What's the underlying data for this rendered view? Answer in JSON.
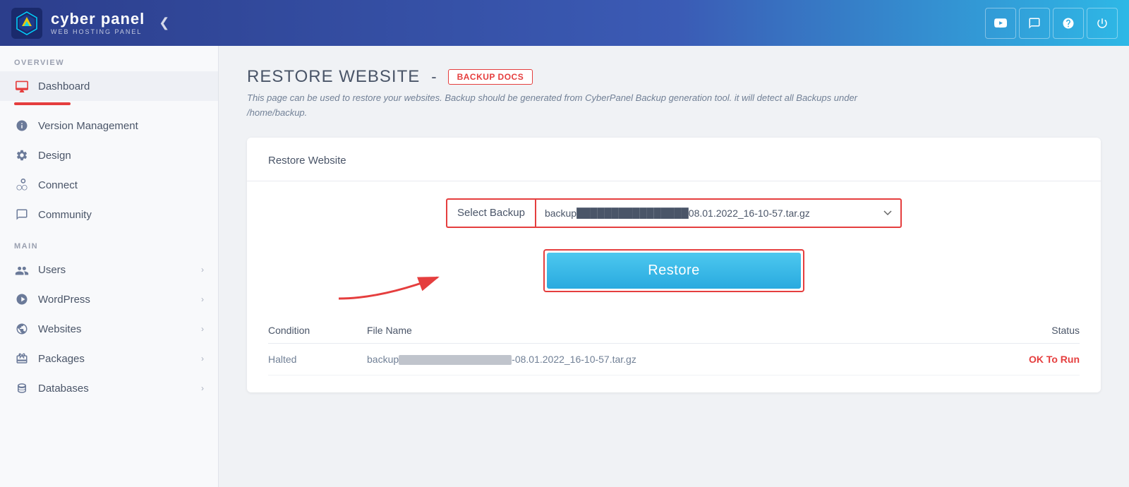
{
  "header": {
    "logo_name": "cyber panel",
    "logo_sub": "WEB HOSTING PANEL",
    "collapse_icon": "❮",
    "icons": [
      {
        "name": "youtube-icon",
        "glyph": "▶",
        "label": "YouTube"
      },
      {
        "name": "chat-icon",
        "glyph": "💬",
        "label": "Chat"
      },
      {
        "name": "help-icon",
        "glyph": "⊕",
        "label": "Help"
      },
      {
        "name": "power-icon",
        "glyph": "⏻",
        "label": "Power"
      }
    ]
  },
  "sidebar": {
    "overview_label": "OVERVIEW",
    "main_label": "MAIN",
    "items_overview": [
      {
        "id": "monitor",
        "label": "Dashboard",
        "icon": "🖥",
        "active": true
      },
      {
        "id": "version",
        "label": "Version Management",
        "icon": "ℹ"
      },
      {
        "id": "design",
        "label": "Design",
        "icon": "⚙"
      },
      {
        "id": "connect",
        "label": "Connect",
        "icon": "🔗"
      },
      {
        "id": "community",
        "label": "Community",
        "icon": "💬"
      }
    ],
    "items_main": [
      {
        "id": "users",
        "label": "Users",
        "icon": "👥",
        "arrow": "›"
      },
      {
        "id": "wordpress",
        "label": "WordPress",
        "icon": "Ⓦ",
        "arrow": "›"
      },
      {
        "id": "websites",
        "label": "Websites",
        "icon": "🌐",
        "arrow": "›"
      },
      {
        "id": "packages",
        "label": "Packages",
        "icon": "📦",
        "arrow": "›"
      },
      {
        "id": "databases",
        "label": "Databases",
        "icon": "🗄",
        "arrow": "›"
      }
    ]
  },
  "page": {
    "title": "RESTORE WEBSITE",
    "title_separator": "-",
    "backup_docs_btn": "BACKUP DOCS",
    "description_line1": "This page can be used to restore your websites. Backup should be generated from CyberPanel Backup generation tool. it will detect all Backups under",
    "description_path": "/home/backup.",
    "card_title": "Restore Website",
    "form": {
      "select_label": "Select Backup",
      "select_value": "backup████████████████08.01.2022_16-10-57.tar.gz",
      "select_display": "backup[redacted]08.01.2022_16-10-57.tar.gz"
    },
    "restore_btn": "Restore",
    "table": {
      "col_condition": "Condition",
      "col_filename": "File Name",
      "col_status": "Status",
      "rows": [
        {
          "condition": "Halted",
          "filename": "backup[redacted]-08.01.2022_16-10-57.tar.gz",
          "status": "OK To Run"
        }
      ]
    }
  },
  "colors": {
    "accent_red": "#e53e3e",
    "accent_blue": "#29aadf",
    "sidebar_bg": "#f8f9fb",
    "header_start": "#2c3e8c",
    "header_end": "#2eb8e6"
  }
}
